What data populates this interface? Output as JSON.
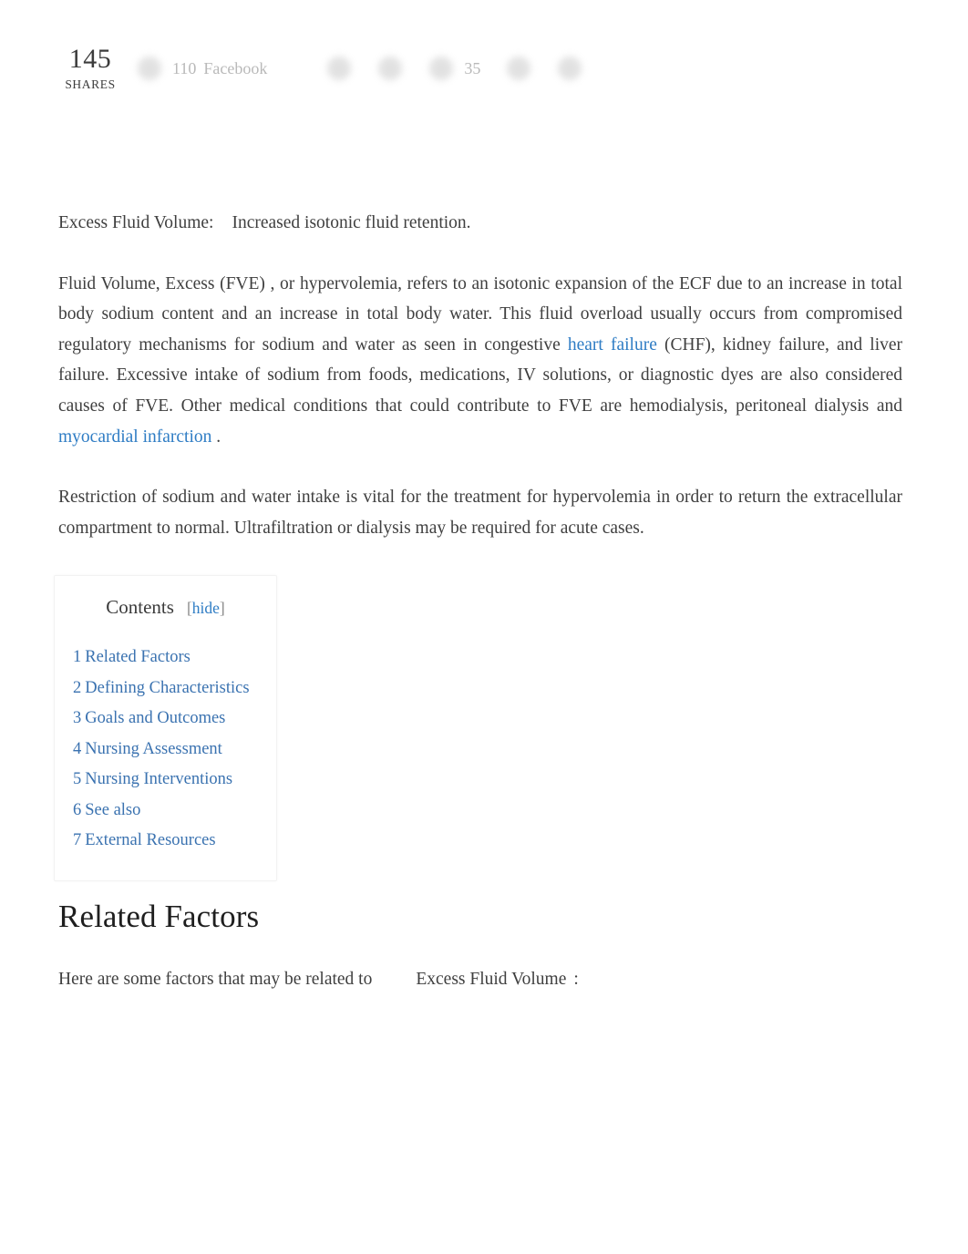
{
  "share_bar": {
    "total": "145",
    "total_label": "SHARES",
    "items": [
      {
        "icon": "facebook-icon",
        "count": "110",
        "network": "Facebook"
      },
      {
        "icon": "twitter-icon",
        "count": "",
        "network": ""
      },
      {
        "icon": "pinterest-icon",
        "count": "",
        "network": ""
      },
      {
        "icon": "linkedin-icon",
        "count": "35",
        "network": ""
      },
      {
        "icon": "email-icon",
        "count": "",
        "network": ""
      },
      {
        "icon": "more-share-icon",
        "count": "",
        "network": ""
      }
    ]
  },
  "article": {
    "definition": {
      "term": "Excess Fluid Volume:",
      "text": "Increased isotonic fluid retention."
    },
    "paragraph_1": {
      "part_1": "Fluid Volume, Excess (FVE)",
      "part_2": ", or hypervolemia, refers to an isotonic expansion of the ECF due to an increase in total body sodium content and an increase in total body water. This fluid overload usually occurs from compromised regulatory mechanisms for sodium and water as seen in congestive",
      "link_1": "heart failure",
      "part_3": "(CHF), kidney failure, and liver failure. Excessive intake of sodium from foods, medications, IV solutions, or diagnostic dyes are also considered causes of FVE. Other medical conditions that could contribute to FVE are hemodialysis, peritoneal dialysis and",
      "link_2": "myocardial infarction",
      "part_4": "."
    },
    "paragraph_2": "Restriction of sodium and water intake is vital for the treatment for hypervolemia in order to return the extracellular compartment to normal. Ultrafiltration or dialysis may be required for acute cases."
  },
  "toc": {
    "title": "Contents",
    "bracket_open": "[",
    "hide_label": "hide",
    "bracket_close": "]",
    "items": [
      {
        "number": "1",
        "label": "Related Factors"
      },
      {
        "number": "2",
        "label": "Defining Characteristics"
      },
      {
        "number": "3",
        "label": "Goals and Outcomes"
      },
      {
        "number": "4",
        "label": "Nursing Assessment"
      },
      {
        "number": "5",
        "label": "Nursing Interventions"
      },
      {
        "number": "6",
        "label": "See also"
      },
      {
        "number": "7",
        "label": "External Resources"
      }
    ]
  },
  "section": {
    "heading": "Related Factors",
    "intro_part_1": "Here are some factors that may be related to",
    "intro_term": "Excess Fluid Volume",
    "intro_part_2": ":"
  },
  "colors": {
    "link_blue": "#2e7cc4",
    "toc_link_blue": "#3a72b0",
    "body_text": "#3f3f3f",
    "heading_text": "#1f1f1f",
    "muted_gray": "#b9b9b9",
    "page_background": "#ffffff"
  }
}
